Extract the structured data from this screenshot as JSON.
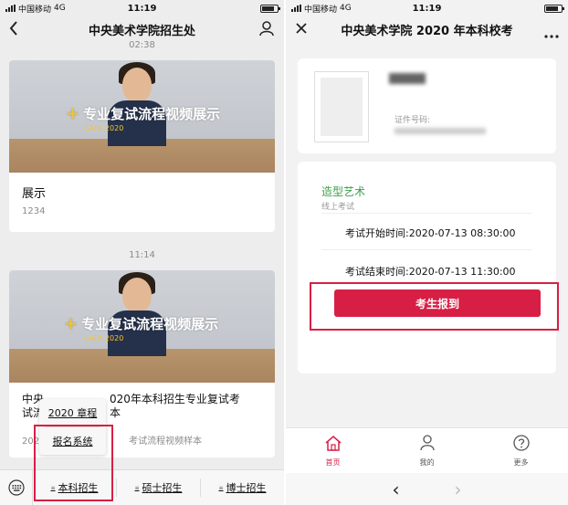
{
  "left": {
    "status": {
      "carrier": "中国移动",
      "network": "4G",
      "time": "11:19"
    },
    "nav": {
      "title": "中央美术学院招生处",
      "back_icon": "chevron-left-icon",
      "profile_icon": "user-icon"
    },
    "feed": {
      "time_top": "02:38",
      "time_mid": "11:14",
      "cards": [
        {
          "overlay": "专业复试流程视频展示",
          "overlay_sub": "CAFA 2020",
          "title": "展示",
          "subtitle": "1234"
        },
        {
          "overlay": "专业复试流程视频展示",
          "overlay_sub": "CAFA 2020",
          "title_a": "中央",
          "title_b": "020年本科招生专业复试考",
          "title_c": "试流",
          "title_d": "本",
          "subtitle_a": "202",
          "subtitle_b": "考试流程视频样本"
        }
      ]
    },
    "popup": {
      "items": [
        "2020 章程",
        "报名系统"
      ]
    },
    "menu": {
      "keyboard_icon": "keyboard-icon",
      "items": [
        "本科招生",
        "硕士招生",
        "博士招生"
      ]
    }
  },
  "right": {
    "status": {
      "carrier": "中国移动",
      "network": "4G",
      "time": "11:19"
    },
    "nav": {
      "title": "中央美术学院 2020 年本科校考",
      "close_icon": "close-icon",
      "more_icon": "more-icon"
    },
    "profile": {
      "id_label": "证件号码:"
    },
    "exam": {
      "name": "造型艺术",
      "type": "线上考试",
      "start": "考试开始时间:2020-07-13 08:30:00",
      "end": "考试结束时间:2020-07-13 11:30:00",
      "button": "考生报到"
    },
    "tabbar": [
      {
        "label": "首页",
        "icon": "home-icon"
      },
      {
        "label": "我的",
        "icon": "person-icon"
      },
      {
        "label": "更多",
        "icon": "help-icon"
      }
    ],
    "browser": {
      "back": "‹",
      "forward": "›"
    }
  },
  "colors": {
    "accent": "#d71f45",
    "green": "#3c9f4b",
    "highlight": "#f3c431"
  }
}
